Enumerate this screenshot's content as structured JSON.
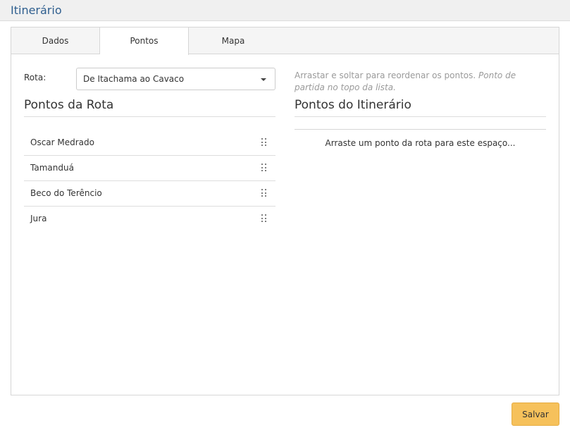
{
  "header": {
    "title": "Itinerário"
  },
  "tabs": [
    {
      "label": "Dados",
      "active": false
    },
    {
      "label": "Pontos",
      "active": true
    },
    {
      "label": "Mapa",
      "active": false
    }
  ],
  "rota": {
    "label": "Rota:",
    "selected": "De Itachama ao Cavaco"
  },
  "help": {
    "text": "Arrastar e soltar para reordenar os pontos.",
    "italic": "Ponto de partida no topo da lista."
  },
  "route_points": {
    "title": "Pontos da Rota",
    "items": [
      {
        "label": "Oscar Medrado"
      },
      {
        "label": "Tamanduá"
      },
      {
        "label": "Beco do Terêncio"
      },
      {
        "label": "Jura"
      }
    ]
  },
  "itinerary_points": {
    "title": "Pontos do Itinerário",
    "placeholder": "Arraste um ponto da rota para este espaço..."
  },
  "footer": {
    "save_label": "Salvar"
  },
  "colors": {
    "header_title": "#2f5f8f",
    "save_button": "#f6c15b"
  }
}
